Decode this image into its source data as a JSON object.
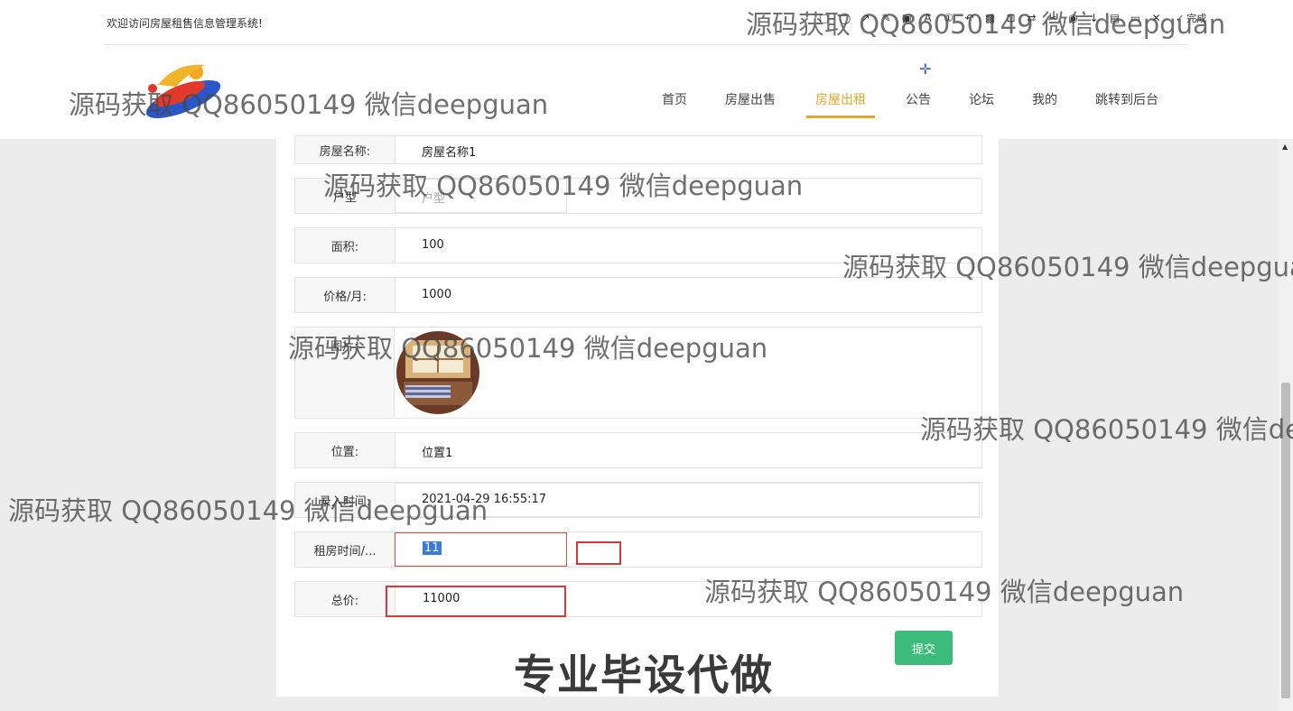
{
  "header": {
    "welcome": "欢迎访问房屋租售信息管理系统!",
    "nav": [
      "首页",
      "房屋出售",
      "房屋出租",
      "公告",
      "论坛",
      "我的",
      "跳转到后台"
    ],
    "active_nav": "房屋出租"
  },
  "toolbar": {
    "done_label": "完成"
  },
  "form": {
    "name_label": "房屋名称:",
    "name_value": "房屋名称1",
    "type_label": "户型",
    "type_value": "户型",
    "area_label": "面积:",
    "area_value": "100",
    "price_label": "价格/月:",
    "price_value": "1000",
    "image_label": "图片:",
    "location_label": "位置:",
    "location_value": "位置1",
    "entry_time_label": "录入时间:",
    "entry_time_value": "2021-04-29 16:55:17",
    "rent_time_label": "租房时间/...",
    "rent_time_value": "11",
    "total_label": "总价:",
    "total_value": "11000",
    "submit_label": "提交"
  },
  "promo": "专业毕设代做",
  "watermark": "源码获取 QQ86050149 微信deepguan",
  "colors": {
    "accent": "#e0a82e",
    "submit": "#3cbc7a",
    "annotation": "#d9383a"
  }
}
